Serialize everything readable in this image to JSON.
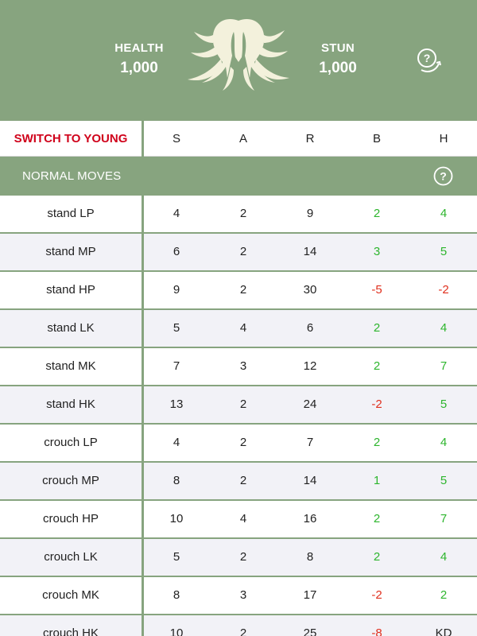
{
  "header": {
    "health_label": "HEALTH",
    "health_value": "1,000",
    "stun_label": "STUN",
    "stun_value": "1,000",
    "portrait_icon": "character-silhouette-icon",
    "help_icon": "help-rotate-icon"
  },
  "columns": {
    "switch_label": "SWITCH TO YOUNG",
    "headers": [
      "S",
      "A",
      "R",
      "B",
      "H"
    ]
  },
  "section": {
    "title": "NORMAL MOVES",
    "help_icon": "help-icon"
  },
  "colors": {
    "accent": "#87a47f",
    "switch": "#d0021b",
    "positive": "#2db52d",
    "negative": "#e0301e"
  },
  "moves": [
    {
      "name": "stand LP",
      "s": "4",
      "a": "2",
      "r": "9",
      "b": "2",
      "h": "4"
    },
    {
      "name": "stand MP",
      "s": "6",
      "a": "2",
      "r": "14",
      "b": "3",
      "h": "5"
    },
    {
      "name": "stand HP",
      "s": "9",
      "a": "2",
      "r": "30",
      "b": "-5",
      "h": "-2"
    },
    {
      "name": "stand LK",
      "s": "5",
      "a": "4",
      "r": "6",
      "b": "2",
      "h": "4"
    },
    {
      "name": "stand MK",
      "s": "7",
      "a": "3",
      "r": "12",
      "b": "2",
      "h": "7"
    },
    {
      "name": "stand HK",
      "s": "13",
      "a": "2",
      "r": "24",
      "b": "-2",
      "h": "5"
    },
    {
      "name": "crouch LP",
      "s": "4",
      "a": "2",
      "r": "7",
      "b": "2",
      "h": "4"
    },
    {
      "name": "crouch MP",
      "s": "8",
      "a": "2",
      "r": "14",
      "b": "1",
      "h": "5"
    },
    {
      "name": "crouch HP",
      "s": "10",
      "a": "4",
      "r": "16",
      "b": "2",
      "h": "7"
    },
    {
      "name": "crouch LK",
      "s": "5",
      "a": "2",
      "r": "8",
      "b": "2",
      "h": "4"
    },
    {
      "name": "crouch MK",
      "s": "8",
      "a": "3",
      "r": "17",
      "b": "-2",
      "h": "2"
    },
    {
      "name": "crouch HK",
      "s": "10",
      "a": "2",
      "r": "25",
      "b": "-8",
      "h": "KD"
    }
  ]
}
